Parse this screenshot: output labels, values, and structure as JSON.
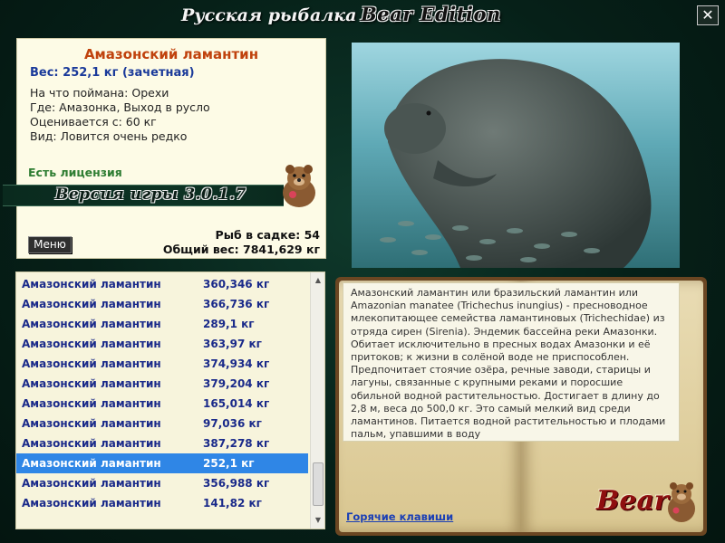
{
  "window": {
    "title": "Русская рыбалка",
    "edition": "Bear Edition",
    "close_label": "✕"
  },
  "info": {
    "fish_name": "Амазонский ламантин",
    "weight": "Вес: 252,1 кг (зачетная)",
    "bait": "На что поймана: Орехи",
    "location": "Где: Амазонка, Выход в русло",
    "valued_from": "Оценивается с: 60 кг",
    "rarity": "Вид: Ловится очень редко",
    "license": "Есть лицензия",
    "version": "Версия игры 3.0.1.7",
    "menu_label": "Меню",
    "cage_count": "Рыб в садке: 54",
    "total_weight": "Общий вес: 7841,629 кг"
  },
  "catch_list": {
    "rows": [
      {
        "name": "Амазонский ламантин",
        "weight": "360,346 кг"
      },
      {
        "name": "Амазонский ламантин",
        "weight": "366,736 кг"
      },
      {
        "name": "Амазонский ламантин",
        "weight": "289,1 кг"
      },
      {
        "name": "Амазонский ламантин",
        "weight": "363,97 кг"
      },
      {
        "name": "Амазонский ламантин",
        "weight": "374,934 кг"
      },
      {
        "name": "Амазонский ламантин",
        "weight": "379,204 кг"
      },
      {
        "name": "Амазонский ламантин",
        "weight": "165,014 кг"
      },
      {
        "name": "Амазонский ламантин",
        "weight": "97,036 кг"
      },
      {
        "name": "Амазонский ламантин",
        "weight": "387,278 кг"
      },
      {
        "name": "Амазонский ламантин",
        "weight": "252,1 кг"
      },
      {
        "name": "Амазонский ламантин",
        "weight": "356,988 кг"
      },
      {
        "name": "Амазонский ламантин",
        "weight": "141,82 кг"
      }
    ],
    "selected_index": 9
  },
  "book": {
    "description": "Амазонский ламантин или бразильский ламантин или Amazonian manatee (Trichechus inungius) - пресноводное млекопитающее семейства ламантиновых (Trichechidae) из отряда сирен (Sirenia). Эндемик бассейна реки Амазонки. Обитает исключительно в пресных водах Амазонки и её притоков; к жизни в солёной воде не приспособлен. Предпочитает стоячие озёра, речные заводи, старицы и лагуны, связанные с крупными реками и поросшие обильной водной растительностью. Достигает в длину до 2,8 м, веса до 500,0 кг. Это самый мелкий вид среди ламантинов. Питается водной растительностью и плодами пальм, упавшими в воду",
    "hotkeys_link": "Горячие клавиши",
    "logo_text": "Bear"
  },
  "colors": {
    "fish_name": "#c0420d",
    "weight": "#1a3a9a",
    "license": "#2e7d32",
    "list_text": "#1a2a8a",
    "selection": "#2f86e6",
    "link": "#1a3fb5"
  }
}
